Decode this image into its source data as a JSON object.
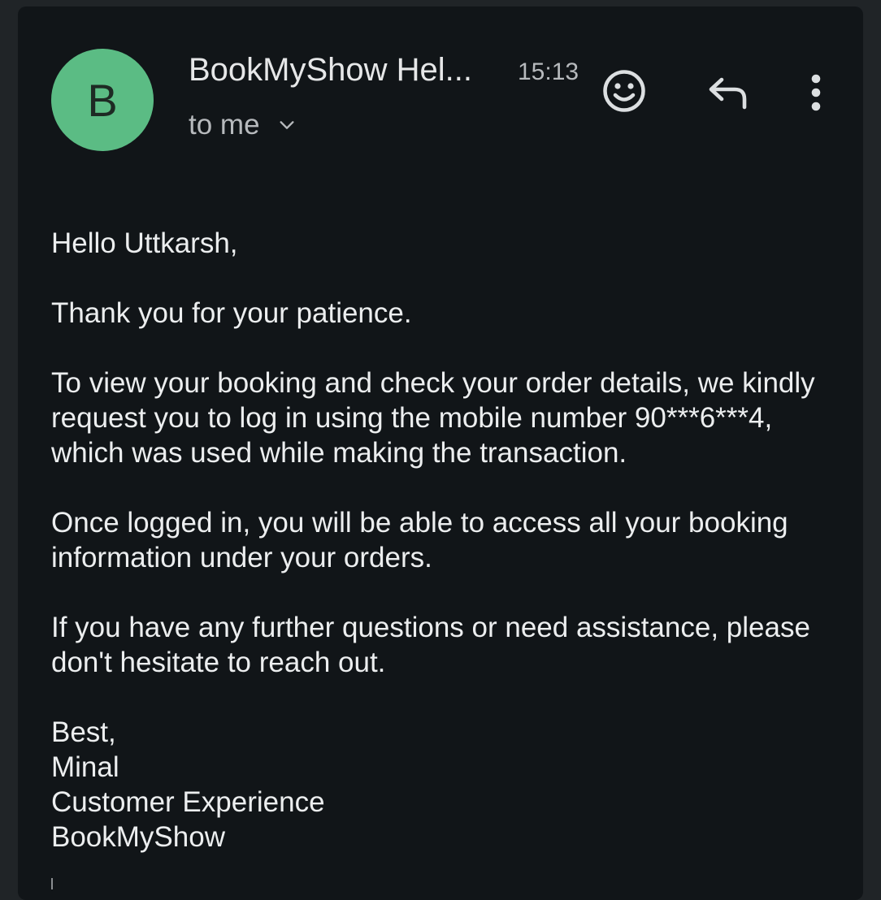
{
  "header": {
    "avatar_letter": "B",
    "sender_name": "BookMyShow Hel...",
    "time": "15:13",
    "recipient_label": "to me"
  },
  "icons": {
    "avatar_color": "#5bbc84",
    "actions": [
      "emoji-reaction-icon",
      "reply-icon",
      "more-vert-icon"
    ],
    "expand": "chevron-down-icon"
  },
  "email": {
    "greeting": "Hello Uttkarsh,",
    "paragraphs": [
      "Thank you for your patience.",
      "To view your booking and check your order details, we kindly request you to log in using the mobile number 90***6***4, which was used while making the transaction.",
      "Once logged in, you will be able to access all your booking information under your orders.",
      "If you have any further questions or need assistance, please don't hesitate to reach out."
    ],
    "signature": [
      "Best,",
      "Minal",
      "Customer Experience",
      "BookMyShow"
    ]
  }
}
